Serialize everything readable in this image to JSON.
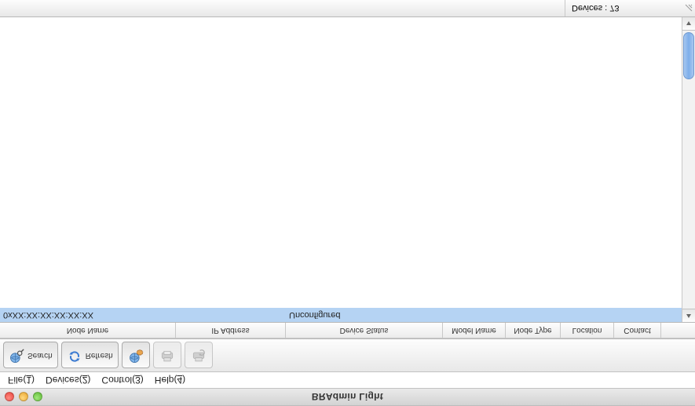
{
  "window": {
    "title": "BRAdmin Light"
  },
  "menus": {
    "file": {
      "label": "File",
      "key": "1"
    },
    "devices": {
      "label": "Devices",
      "key": "2"
    },
    "control": {
      "label": "Control",
      "key": "3"
    },
    "help": {
      "label": "Help",
      "key": "4"
    }
  },
  "toolbar": {
    "search_label": "Search",
    "refresh_label": "Refresh"
  },
  "columns": {
    "nodename": "Node Name",
    "ip": "IP Address",
    "status": "Device Status",
    "model": "Model Name",
    "nodetype": "Node Type",
    "location": "Location",
    "contact": "Contact"
  },
  "rows": [
    {
      "nodename": "0xXX:XX:XX:XX:XX:XX",
      "ip": "",
      "status": "Unconfigured",
      "model": "",
      "nodetype": "",
      "location": "",
      "contact": ""
    }
  ],
  "status": {
    "devices_label": "Devices : 73"
  }
}
